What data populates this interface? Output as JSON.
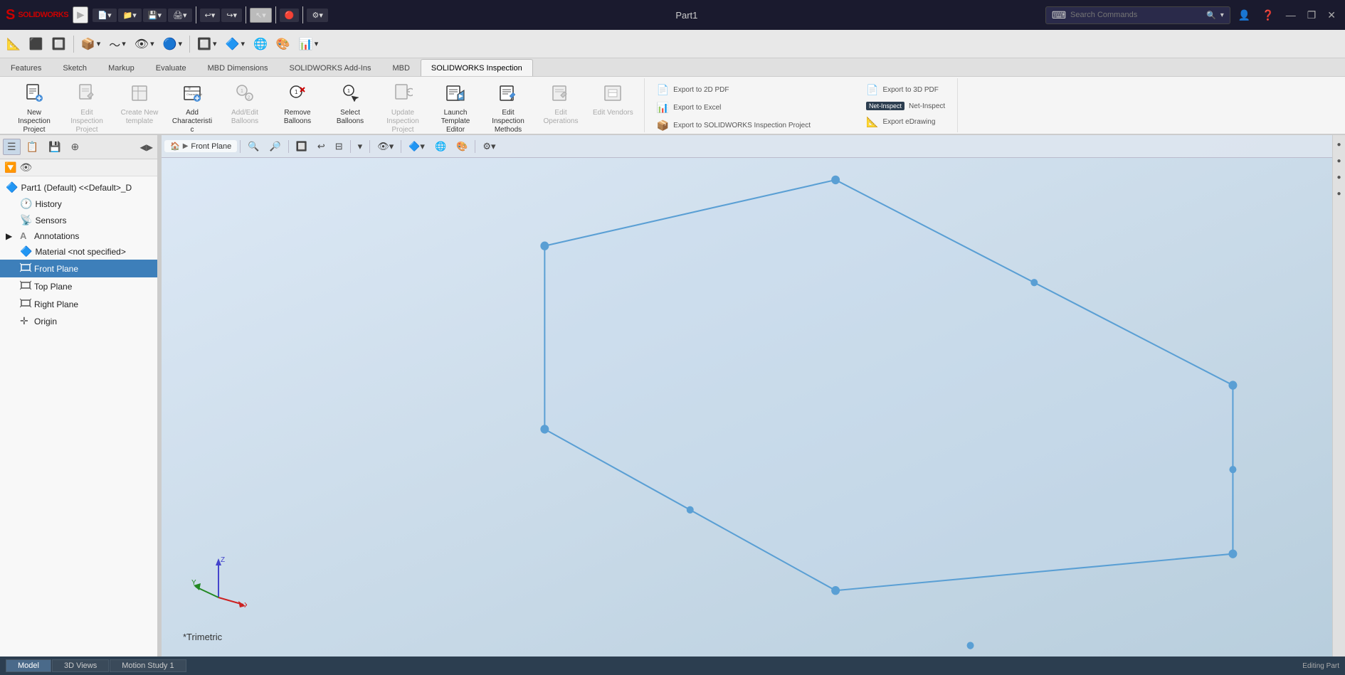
{
  "titlebar": {
    "logo": "SOLIDWORKS",
    "title": "Part1",
    "search_placeholder": "Search Commands",
    "tools": [
      {
        "id": "new",
        "icon": "📄",
        "label": "New"
      },
      {
        "id": "open",
        "icon": "📁",
        "label": "Open"
      },
      {
        "id": "save",
        "icon": "💾",
        "label": "Save"
      },
      {
        "id": "print",
        "icon": "🖨",
        "label": "Print"
      },
      {
        "id": "undo",
        "icon": "↩",
        "label": "Undo"
      },
      {
        "id": "redo",
        "icon": "↪",
        "label": "Redo"
      },
      {
        "id": "select",
        "icon": "↖",
        "label": "Select"
      },
      {
        "id": "rebuild",
        "icon": "🔴",
        "label": "Rebuild"
      },
      {
        "id": "options",
        "icon": "⚙",
        "label": "Options"
      }
    ],
    "window_controls": [
      "—",
      "❐",
      "✕"
    ]
  },
  "ribbon": {
    "tabs": [
      {
        "id": "features",
        "label": "Features"
      },
      {
        "id": "sketch",
        "label": "Sketch"
      },
      {
        "id": "markup",
        "label": "Markup"
      },
      {
        "id": "evaluate",
        "label": "Evaluate"
      },
      {
        "id": "mbd-dimensions",
        "label": "MBD Dimensions"
      },
      {
        "id": "solidworks-addins",
        "label": "SOLIDWORKS Add-Ins"
      },
      {
        "id": "mbd",
        "label": "MBD"
      },
      {
        "id": "solidworks-inspection",
        "label": "SOLIDWORKS Inspection",
        "active": true
      }
    ],
    "groups": [
      {
        "id": "project",
        "buttons": [
          {
            "id": "new-inspection",
            "icon": "📋",
            "label": "New Inspection Project",
            "enabled": true
          },
          {
            "id": "edit-inspection",
            "icon": "✏️",
            "label": "Edit Inspection Project",
            "enabled": false
          },
          {
            "id": "create-new-template",
            "icon": "📄",
            "label": "Create New template",
            "enabled": false
          },
          {
            "id": "add-characteristic",
            "icon": "➕",
            "label": "Add Characteristic",
            "enabled": true
          },
          {
            "id": "add-edit-balloons",
            "icon": "🔵",
            "label": "Add/Edit Balloons",
            "enabled": false
          },
          {
            "id": "remove-balloons",
            "icon": "❌",
            "label": "Remove Balloons",
            "enabled": true
          },
          {
            "id": "select-balloons",
            "icon": "🎯",
            "label": "Select Balloons",
            "enabled": true
          },
          {
            "id": "update-inspection",
            "icon": "🔄",
            "label": "Update Inspection Project",
            "enabled": false
          },
          {
            "id": "launch-template-editor",
            "icon": "📝",
            "label": "Launch Template Editor",
            "enabled": true
          },
          {
            "id": "edit-inspection-methods",
            "icon": "⚙",
            "label": "Edit Inspection Methods",
            "enabled": true
          },
          {
            "id": "edit-operations",
            "icon": "🔧",
            "label": "Edit Operations",
            "enabled": false
          },
          {
            "id": "edit-vendors",
            "icon": "🏢",
            "label": "Edit Vendors",
            "enabled": false
          }
        ]
      }
    ],
    "export_buttons": [
      {
        "id": "export-2d-pdf",
        "label": "Export to 2D PDF",
        "icon": "📄"
      },
      {
        "id": "export-3d-pdf",
        "label": "Export to 3D PDF",
        "icon": "📄"
      },
      {
        "id": "net-inspect",
        "label": "Net-Inspect",
        "icon": "NI"
      },
      {
        "id": "export-excel",
        "label": "Export to Excel",
        "icon": "📊"
      },
      {
        "id": "export-edrawing",
        "label": "Export eDrawing",
        "icon": "📐"
      },
      {
        "id": "export-sw-project",
        "label": "Export to SOLIDWORKS Inspection Project",
        "icon": "📦"
      }
    ]
  },
  "secondary_toolbar": {
    "buttons": [
      "⚙",
      "☰",
      "💾",
      "⊕",
      "🔄",
      "▶",
      "◀"
    ]
  },
  "left_panel": {
    "toolbar_buttons": [
      "☰",
      "📋",
      "💾",
      "⊕",
      "🔧"
    ],
    "tree": {
      "root": "Part1 (Default) <<Default>_D",
      "items": [
        {
          "id": "history",
          "icon": "🕐",
          "label": "History",
          "indent": 0
        },
        {
          "id": "sensors",
          "icon": "📡",
          "label": "Sensors",
          "indent": 0
        },
        {
          "id": "annotations",
          "icon": "🅰",
          "label": "Annotations",
          "indent": 0
        },
        {
          "id": "material",
          "icon": "🔷",
          "label": "Material <not specified>",
          "indent": 0
        },
        {
          "id": "front-plane",
          "icon": "⬜",
          "label": "Front Plane",
          "indent": 0,
          "selected": true
        },
        {
          "id": "top-plane",
          "icon": "⬜",
          "label": "Top Plane",
          "indent": 0
        },
        {
          "id": "right-plane",
          "icon": "⬜",
          "label": "Right Plane",
          "indent": 0
        },
        {
          "id": "origin",
          "icon": "✛",
          "label": "Origin",
          "indent": 0
        }
      ]
    }
  },
  "viewport": {
    "breadcrumb": [
      "Front Plane"
    ],
    "view_label": "*Trimetric",
    "plane_color": "#5a9fd4",
    "bg_gradient_start": "#e8eef5",
    "bg_gradient_end": "#c8d8e8"
  },
  "statusbar": {
    "tabs": [
      {
        "id": "model",
        "label": "Model",
        "active": true
      },
      {
        "id": "3d-view",
        "label": "3D Views"
      },
      {
        "id": "motion-study",
        "label": "Motion Study 1"
      }
    ]
  }
}
